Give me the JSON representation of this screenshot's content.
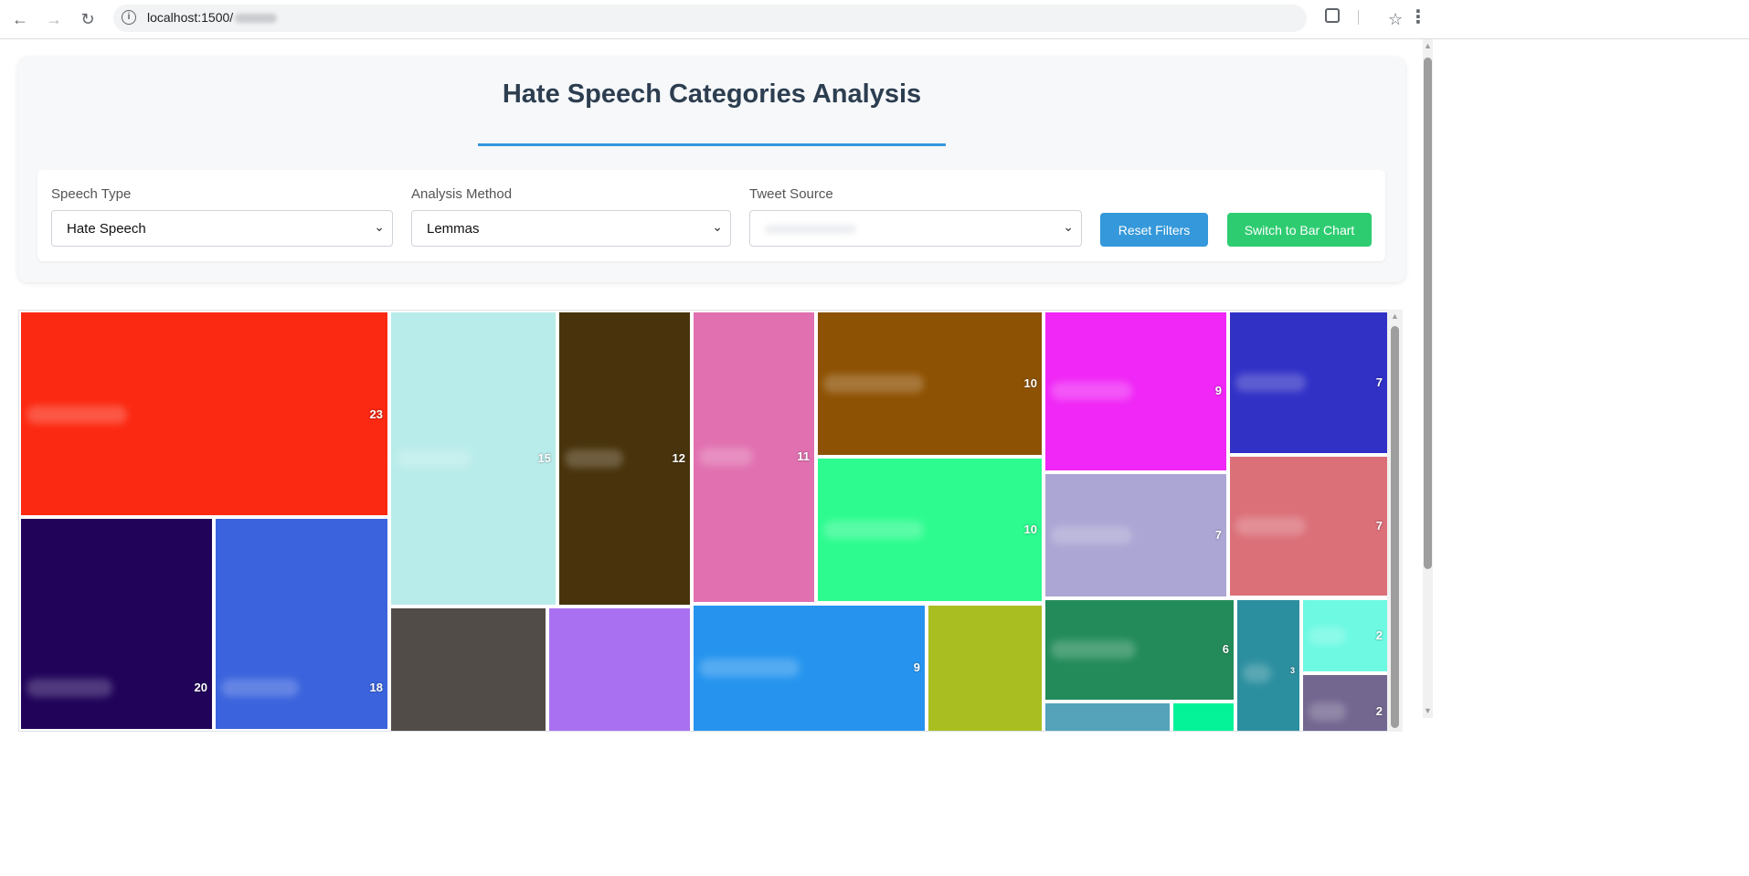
{
  "browser": {
    "url_prefix": "localhost:1500/",
    "back_icon": "arrow-left-icon",
    "forward_icon": "arrow-right-icon",
    "reload_icon": "reload-icon"
  },
  "page": {
    "title": "Hate Speech Categories Analysis",
    "accent_color": "#3498db"
  },
  "filters": {
    "speech_type": {
      "label": "Speech Type",
      "value": "Hate Speech"
    },
    "analysis_method": {
      "label": "Analysis Method",
      "value": "Lemmas"
    },
    "tweet_source": {
      "label": "Tweet Source",
      "value": ""
    },
    "reset_label": "Reset Filters",
    "switch_label": "Switch to Bar Chart",
    "reset_color": "#3498db",
    "switch_color": "#2ecc71"
  },
  "treemap": {
    "tiles": [
      {
        "count": "23",
        "color": "#fb2912"
      },
      {
        "count": "20",
        "color": "#21045a"
      },
      {
        "count": "18",
        "color": "#3a63dd"
      },
      {
        "count": "15",
        "color": "#b8ecea"
      },
      {
        "count": "12",
        "color": "#48330c"
      },
      {
        "count": "11",
        "color": "#e170b0"
      },
      {
        "count": "10",
        "color": "#8e5204"
      },
      {
        "count": "10",
        "color": "#2dfb8f"
      },
      {
        "count": "9",
        "color": "#f027f6"
      },
      {
        "count": "7",
        "color": "#3131c6"
      },
      {
        "count": "7",
        "color": "#aba6d4"
      },
      {
        "count": "7",
        "color": "#db7079"
      },
      {
        "count": "9",
        "color": "#2694ee"
      },
      {
        "count": "6",
        "color": "#238b5a"
      },
      {
        "count": "3",
        "color": "#2c8f9f"
      },
      {
        "count": "2",
        "color": "#6df9e2"
      },
      {
        "count": "2",
        "color": "#736790"
      },
      {
        "count": "",
        "color": "#524c48"
      },
      {
        "count": "",
        "color": "#a971f1"
      },
      {
        "count": "",
        "color": "#a9bf21"
      },
      {
        "count": "",
        "color": "#54a3bb"
      },
      {
        "count": "",
        "color": "#05f398"
      }
    ]
  }
}
